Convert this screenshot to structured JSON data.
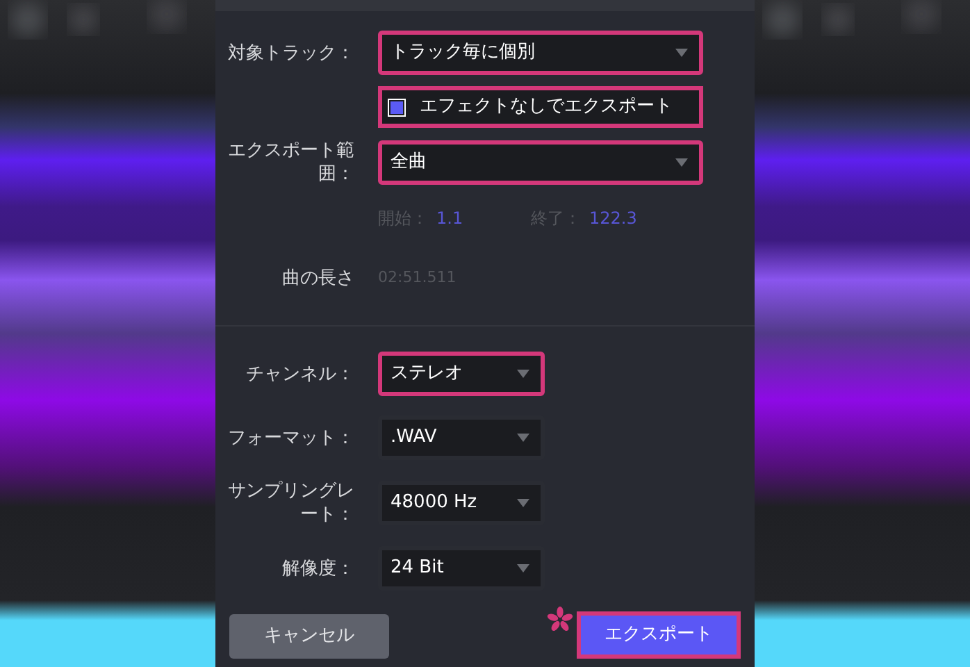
{
  "form": {
    "fields": [
      {
        "kind": "select",
        "label": "対象トラック：",
        "value": "トラック毎に個別",
        "highlighted": true
      },
      {
        "kind": "checkbox",
        "text": "エフェクトなしでエクスポート",
        "checked": true,
        "highlighted": true
      },
      {
        "kind": "select",
        "label": "エクスポート範囲：",
        "value": "全曲",
        "highlighted": true
      },
      {
        "kind": "range",
        "start_label": "開始：",
        "start": "1.1",
        "end_label": "終了：",
        "end": "122.3"
      },
      {
        "kind": "info",
        "label": "曲の長さ",
        "value": "02:51.511"
      },
      {
        "kind": "divider"
      },
      {
        "kind": "dropdown",
        "label": "チャンネル：",
        "value": "ステレオ",
        "highlighted": true
      },
      {
        "kind": "dropdown",
        "label": "フォーマット：",
        "value": ".WAV",
        "highlighted": false
      },
      {
        "kind": "dropdown",
        "label": "サンプリングレート：",
        "value": "48000 Hz",
        "highlighted": false
      },
      {
        "kind": "dropdown",
        "label": "解像度：",
        "value": "24 Bit",
        "highlighted": false
      }
    ]
  },
  "buttons": {
    "cancel": {
      "label": "キャンセル",
      "highlighted": false
    },
    "export": {
      "label": "エクスポート",
      "highlighted": true
    }
  }
}
